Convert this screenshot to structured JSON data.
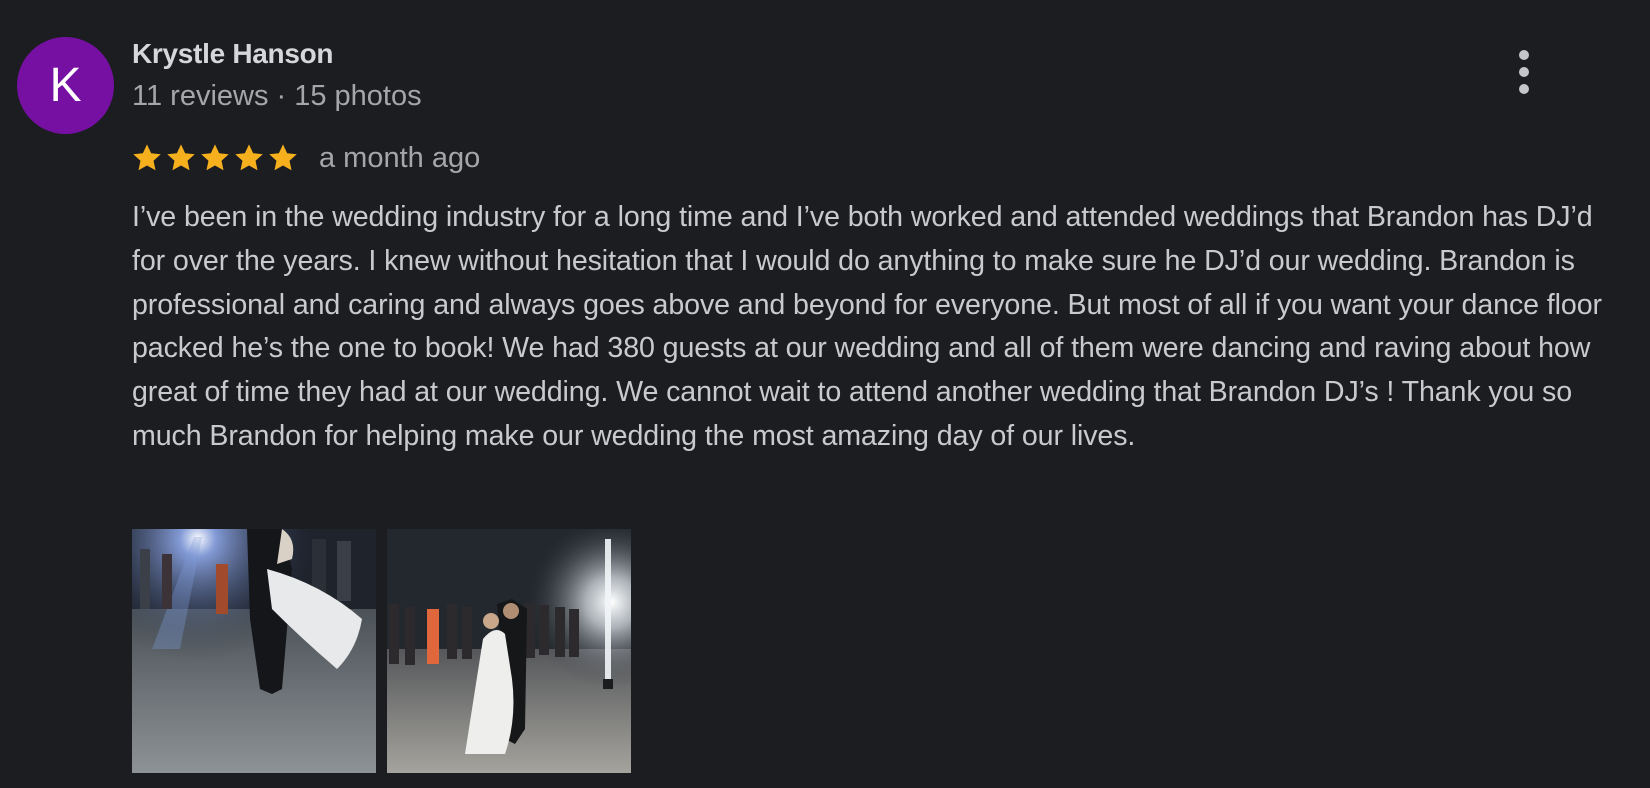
{
  "review": {
    "avatar_letter": "K",
    "avatar_color": "#7610a3",
    "reviewer_name": "Krystle Hanson",
    "reviewer_meta": "11 reviews · 15 photos",
    "rating": 5,
    "rating_max": 5,
    "star_color": "#f6b01e",
    "time_ago": "a month ago",
    "text": "I’ve been in the wedding industry for a long time and I’ve both worked and attended weddings that Brandon has DJ’d for over the years. I knew without hesitation that I would do anything to make sure he DJ’d our wedding. Brandon is professional and caring and always goes above and beyond for everyone. But most of all if you want your dance floor packed he’s the one to book! We had 380 guests at our wedding and all of them were dancing and raving about how great of time they had at our wedding. We cannot wait to attend another wedding that Brandon DJ’s ! Thank you so much Brandon for helping make our wedding the most amazing day of our lives.",
    "menu_icon": "more-vert-icon",
    "photos": [
      {
        "icon": "photo-thumbnail"
      },
      {
        "icon": "photo-thumbnail"
      }
    ]
  }
}
